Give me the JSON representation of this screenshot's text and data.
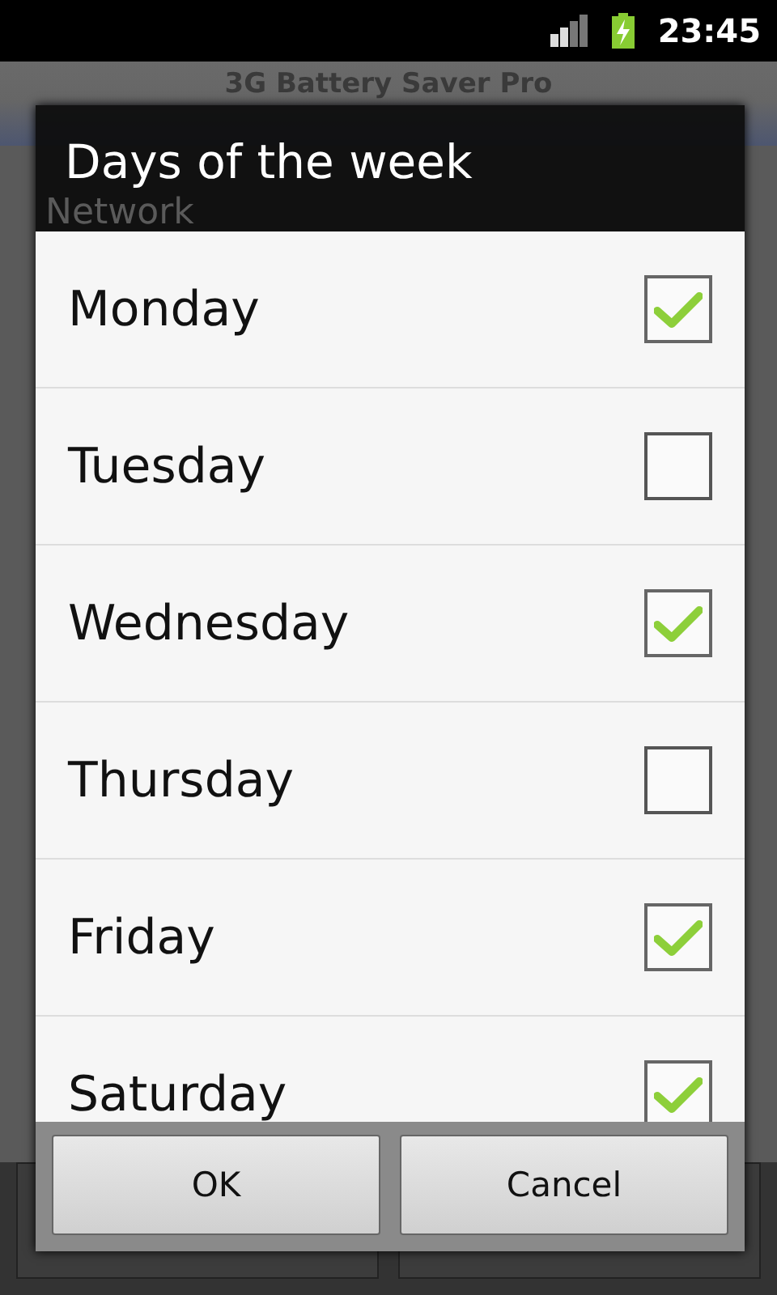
{
  "status_bar": {
    "time": "23:45"
  },
  "background_app": {
    "title": "3G Battery Saver Pro",
    "section": "Network"
  },
  "dialog": {
    "title": "Days of the week",
    "items": [
      {
        "label": "Monday",
        "checked": true
      },
      {
        "label": "Tuesday",
        "checked": false
      },
      {
        "label": "Wednesday",
        "checked": true
      },
      {
        "label": "Thursday",
        "checked": false
      },
      {
        "label": "Friday",
        "checked": true
      },
      {
        "label": "Saturday",
        "checked": true
      }
    ],
    "buttons": [
      "OK",
      "Cancel"
    ]
  }
}
